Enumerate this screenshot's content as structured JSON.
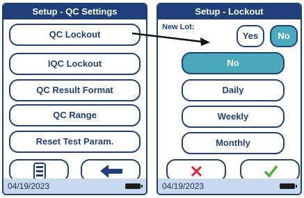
{
  "left_screen": {
    "title": "Setup - QC Settings",
    "menu": [
      {
        "label": "QC Lockout"
      },
      {
        "label": "IQC Lockout"
      },
      {
        "label": "QC Result Format"
      },
      {
        "label": "QC Range"
      },
      {
        "label": "Reset Test Param."
      }
    ],
    "icons": {
      "menu": "list-icon",
      "back": "back-arrow-icon"
    },
    "date": "04/19/2023"
  },
  "right_screen": {
    "title": "Setup - Lockout",
    "new_lot_label": "New Lot:",
    "new_lot_options": [
      {
        "label": "Yes",
        "selected": false
      },
      {
        "label": "No",
        "selected": true
      }
    ],
    "options": [
      {
        "label": "No",
        "selected": true
      },
      {
        "label": "Daily",
        "selected": false
      },
      {
        "label": "Weekly",
        "selected": false
      },
      {
        "label": "Monthly",
        "selected": false
      }
    ],
    "icons": {
      "cancel": "red-x-icon",
      "confirm": "green-check-icon"
    },
    "date": "04/19/2023"
  },
  "colors": {
    "frame": "#1e3f7a",
    "selected": "#4aaabb",
    "footer": "#c8d8ee",
    "cancel": "#e0202a",
    "confirm": "#4caf3a"
  }
}
